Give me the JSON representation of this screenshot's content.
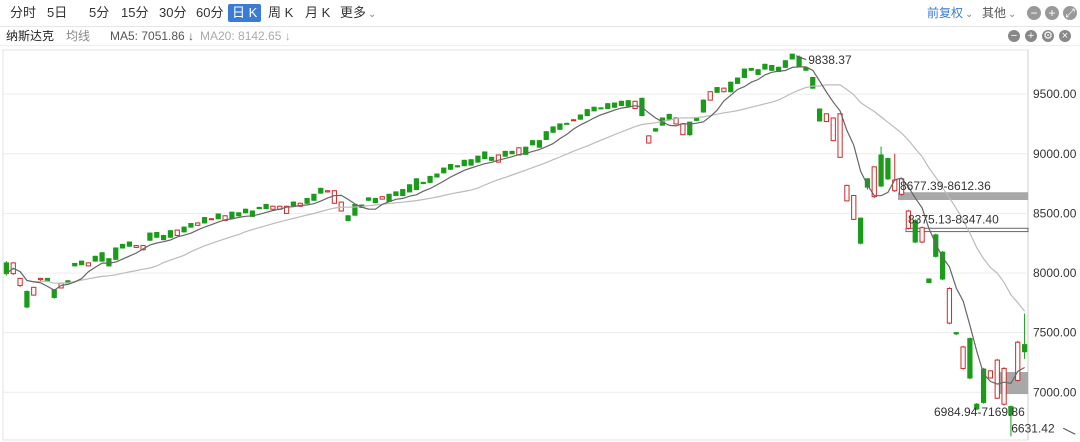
{
  "toolbar": {
    "periods": [
      "分时",
      "5日",
      "5分",
      "15分",
      "30分",
      "60分",
      "日 K",
      "周 K",
      "月 K",
      "更多"
    ],
    "active_period": "日 K",
    "adjust_label": "前复权",
    "other_label": "其他"
  },
  "info": {
    "name": "纳斯达克",
    "ma_label": "均线",
    "ma5": "MA5: 7051.86 ↓",
    "ma20": "MA20: 8142.65 ↓"
  },
  "colors": {
    "up": "#cc2b2b",
    "down": "#1a9c1a",
    "ma5": "#666666",
    "ma20": "#bbbbbb",
    "zone": "#9e9e9e",
    "active": "#3a7bd5"
  },
  "chart_data": {
    "type": "candlestick",
    "ylim": [
      6600,
      9870
    ],
    "y_ticks": [
      "7000.00",
      "7500.00",
      "8000.00",
      "8500.00",
      "9000.00",
      "9500.00"
    ],
    "candles": [
      [
        8085,
        7995,
        8100,
        7980
      ],
      [
        7995,
        8085,
        8090,
        7985
      ],
      [
        7895,
        7955,
        7960,
        7885
      ],
      [
        7845,
        7715,
        7855,
        7705
      ],
      [
        7815,
        7880,
        7885,
        7810
      ],
      [
        7945,
        7955,
        7960,
        7930
      ],
      [
        7955,
        7935,
        7958,
        7925
      ],
      [
        7860,
        7795,
        7865,
        7785
      ],
      [
        7875,
        7915,
        7920,
        7870
      ],
      [
        7935,
        7925,
        7940,
        7920
      ],
      [
        8080,
        8060,
        8085,
        8055
      ],
      [
        8100,
        8070,
        8105,
        8065
      ],
      [
        8060,
        8085,
        8090,
        8055
      ],
      [
        8140,
        8100,
        8145,
        8095
      ],
      [
        8170,
        8100,
        8175,
        8095
      ],
      [
        8120,
        8060,
        8125,
        8055
      ],
      [
        8210,
        8115,
        8215,
        8110
      ],
      [
        8240,
        8210,
        8245,
        8205
      ],
      [
        8260,
        8225,
        8265,
        8220
      ],
      [
        8215,
        8230,
        8235,
        8210
      ],
      [
        8195,
        8230,
        8235,
        8190
      ],
      [
        8335,
        8275,
        8340,
        8270
      ],
      [
        8340,
        8300,
        8345,
        8295
      ],
      [
        8315,
        8280,
        8320,
        8275
      ],
      [
        8355,
        8300,
        8360,
        8295
      ],
      [
        8315,
        8360,
        8365,
        8310
      ],
      [
        8385,
        8345,
        8390,
        8340
      ],
      [
        8415,
        8385,
        8420,
        8380
      ],
      [
        8400,
        8420,
        8425,
        8395
      ],
      [
        8465,
        8420,
        8470,
        8415
      ],
      [
        8450,
        8455,
        8460,
        8445
      ],
      [
        8495,
        8455,
        8500,
        8450
      ],
      [
        8440,
        8480,
        8485,
        8435
      ],
      [
        8510,
        8460,
        8515,
        8455
      ],
      [
        8505,
        8480,
        8510,
        8475
      ],
      [
        8535,
        8505,
        8540,
        8500
      ],
      [
        8520,
        8475,
        8525,
        8470
      ],
      [
        8550,
        8540,
        8555,
        8535
      ],
      [
        8575,
        8540,
        8580,
        8535
      ],
      [
        8535,
        8560,
        8565,
        8530
      ],
      [
        8535,
        8560,
        8565,
        8530
      ],
      [
        8500,
        8560,
        8565,
        8495
      ],
      [
        8595,
        8565,
        8600,
        8560
      ],
      [
        8560,
        8585,
        8590,
        8555
      ],
      [
        8625,
        8585,
        8630,
        8580
      ],
      [
        8660,
        8610,
        8665,
        8605
      ],
      [
        8710,
        8670,
        8715,
        8665
      ],
      [
        8680,
        8690,
        8695,
        8675
      ],
      [
        8585,
        8690,
        8695,
        8580
      ],
      [
        8520,
        8595,
        8600,
        8515
      ],
      [
        8480,
        8440,
        8485,
        8435
      ],
      [
        8575,
        8485,
        8580,
        8480
      ],
      [
        8570,
        8550,
        8575,
        8545
      ],
      [
        8630,
        8610,
        8635,
        8605
      ],
      [
        8625,
        8590,
        8630,
        8585
      ],
      [
        8620,
        8640,
        8645,
        8615
      ],
      [
        8660,
        8600,
        8665,
        8595
      ],
      [
        8680,
        8650,
        8685,
        8645
      ],
      [
        8700,
        8650,
        8705,
        8645
      ],
      [
        8740,
        8680,
        8745,
        8675
      ],
      [
        8790,
        8700,
        8795,
        8695
      ],
      [
        8760,
        8750,
        8765,
        8745
      ],
      [
        8810,
        8760,
        8815,
        8755
      ],
      [
        8830,
        8805,
        8835,
        8800
      ],
      [
        8880,
        8840,
        8885,
        8835
      ],
      [
        8910,
        8870,
        8915,
        8865
      ],
      [
        8900,
        8890,
        8905,
        8885
      ],
      [
        8945,
        8900,
        8950,
        8895
      ],
      [
        8950,
        8905,
        8955,
        8900
      ],
      [
        8980,
        8930,
        8985,
        8925
      ],
      [
        9015,
        8960,
        9020,
        8955
      ],
      [
        8970,
        8945,
        8975,
        8940
      ],
      [
        8930,
        8990,
        8995,
        8925
      ],
      [
        9020,
        8980,
        9025,
        8975
      ],
      [
        9020,
        9000,
        9025,
        8995
      ],
      [
        8990,
        9050,
        9055,
        8985
      ],
      [
        9055,
        8995,
        9060,
        8990
      ],
      [
        9110,
        9075,
        9115,
        9070
      ],
      [
        9110,
        9055,
        9115,
        9050
      ],
      [
        9185,
        9120,
        9190,
        9115
      ],
      [
        9225,
        9180,
        9230,
        9175
      ],
      [
        9250,
        9205,
        9255,
        9200
      ],
      [
        9255,
        9250,
        9260,
        9245
      ],
      [
        9280,
        9285,
        9290,
        9275
      ],
      [
        9325,
        9290,
        9330,
        9285
      ],
      [
        9370,
        9320,
        9375,
        9315
      ],
      [
        9390,
        9360,
        9395,
        9355
      ],
      [
        9385,
        9380,
        9390,
        9375
      ],
      [
        9420,
        9380,
        9425,
        9375
      ],
      [
        9425,
        9390,
        9430,
        9385
      ],
      [
        9440,
        9405,
        9445,
        9400
      ],
      [
        9445,
        9400,
        9450,
        9395
      ],
      [
        9380,
        9440,
        9445,
        9375
      ],
      [
        9465,
        9320,
        9470,
        9315
      ],
      [
        9090,
        9150,
        9155,
        9085
      ],
      [
        9210,
        9190,
        9215,
        9185
      ],
      [
        9300,
        9240,
        9305,
        9235
      ],
      [
        9330,
        9290,
        9335,
        9285
      ],
      [
        9250,
        9300,
        9305,
        9245
      ],
      [
        9160,
        9250,
        9255,
        9155
      ],
      [
        9265,
        9160,
        9270,
        9150
      ],
      [
        9300,
        9280,
        9305,
        9275
      ],
      [
        9450,
        9350,
        9455,
        9345
      ],
      [
        9450,
        9520,
        9525,
        9445
      ],
      [
        9555,
        9515,
        9560,
        9510
      ],
      [
        9520,
        9550,
        9555,
        9515
      ],
      [
        9600,
        9520,
        9605,
        9515
      ],
      [
        9635,
        9590,
        9640,
        9585
      ],
      [
        9710,
        9640,
        9715,
        9635
      ],
      [
        9715,
        9700,
        9720,
        9695
      ],
      [
        9705,
        9665,
        9710,
        9660
      ],
      [
        9750,
        9710,
        9755,
        9705
      ],
      [
        9740,
        9700,
        9745,
        9695
      ],
      [
        9725,
        9690,
        9730,
        9685
      ],
      [
        9780,
        9725,
        9785,
        9720
      ],
      [
        9835,
        9795,
        9838,
        9790
      ],
      [
        9810,
        9730,
        9825,
        9725
      ],
      [
        9720,
        9700,
        9725,
        9695
      ],
      [
        9640,
        9550,
        9645,
        9545
      ],
      [
        9375,
        9275,
        9380,
        9270
      ],
      [
        9270,
        9335,
        9340,
        9265
      ],
      [
        9110,
        9300,
        9305,
        9105
      ],
      [
        8970,
        9335,
        9340,
        8965
      ],
      [
        8605,
        8735,
        8740,
        8600
      ],
      [
        8450,
        8650,
        8655,
        8445
      ],
      [
        8460,
        8250,
        8465,
        8240
      ],
      [
        8790,
        8720,
        8795,
        8700
      ],
      [
        8640,
        8890,
        8895,
        8630
      ],
      [
        8990,
        8730,
        9060,
        8720
      ],
      [
        8960,
        8790,
        8965,
        8780
      ],
      [
        8690,
        8780,
        9000,
        8680
      ],
      [
        8660,
        8790,
        8800,
        8650
      ],
      [
        8375,
        8520,
        8530,
        8365
      ],
      [
        8440,
        8260,
        8450,
        8250
      ],
      [
        8260,
        8380,
        8390,
        8250
      ],
      [
        7950,
        7920,
        7955,
        7915
      ],
      [
        8320,
        8140,
        8330,
        8130
      ],
      [
        8175,
        7950,
        8185,
        7940
      ],
      [
        7580,
        7870,
        7880,
        7570
      ],
      [
        7500,
        7490,
        7505,
        7480
      ],
      [
        7200,
        7380,
        7390,
        7190
      ],
      [
        7450,
        7120,
        7460,
        7110
      ],
      [
        6900,
        6860,
        6910,
        6850
      ],
      [
        7195,
        6915,
        7205,
        6905
      ],
      [
        7120,
        7180,
        7185,
        7115
      ],
      [
        6950,
        7270,
        7280,
        6945
      ],
      [
        6900,
        7200,
        7210,
        6890
      ],
      [
        6880,
        6810,
        6890,
        6631
      ],
      [
        7100,
        7420,
        7430,
        7090
      ],
      [
        7400,
        7340,
        7660,
        7280
      ]
    ],
    "annotations": [
      {
        "text": "9838.37",
        "price": 9838.37,
        "bar": 115
      },
      {
        "text": "6631.42",
        "price": 6631.42,
        "bar": 157
      },
      {
        "text": "8677.39-8612.36",
        "low": 8612.36,
        "high": 8677.39
      },
      {
        "text": "8375.13-8347.40",
        "low": 8347.4,
        "high": 8375.13
      },
      {
        "text": "6984.94-7169.86",
        "low": 6984.94,
        "high": 7169.86
      }
    ]
  }
}
